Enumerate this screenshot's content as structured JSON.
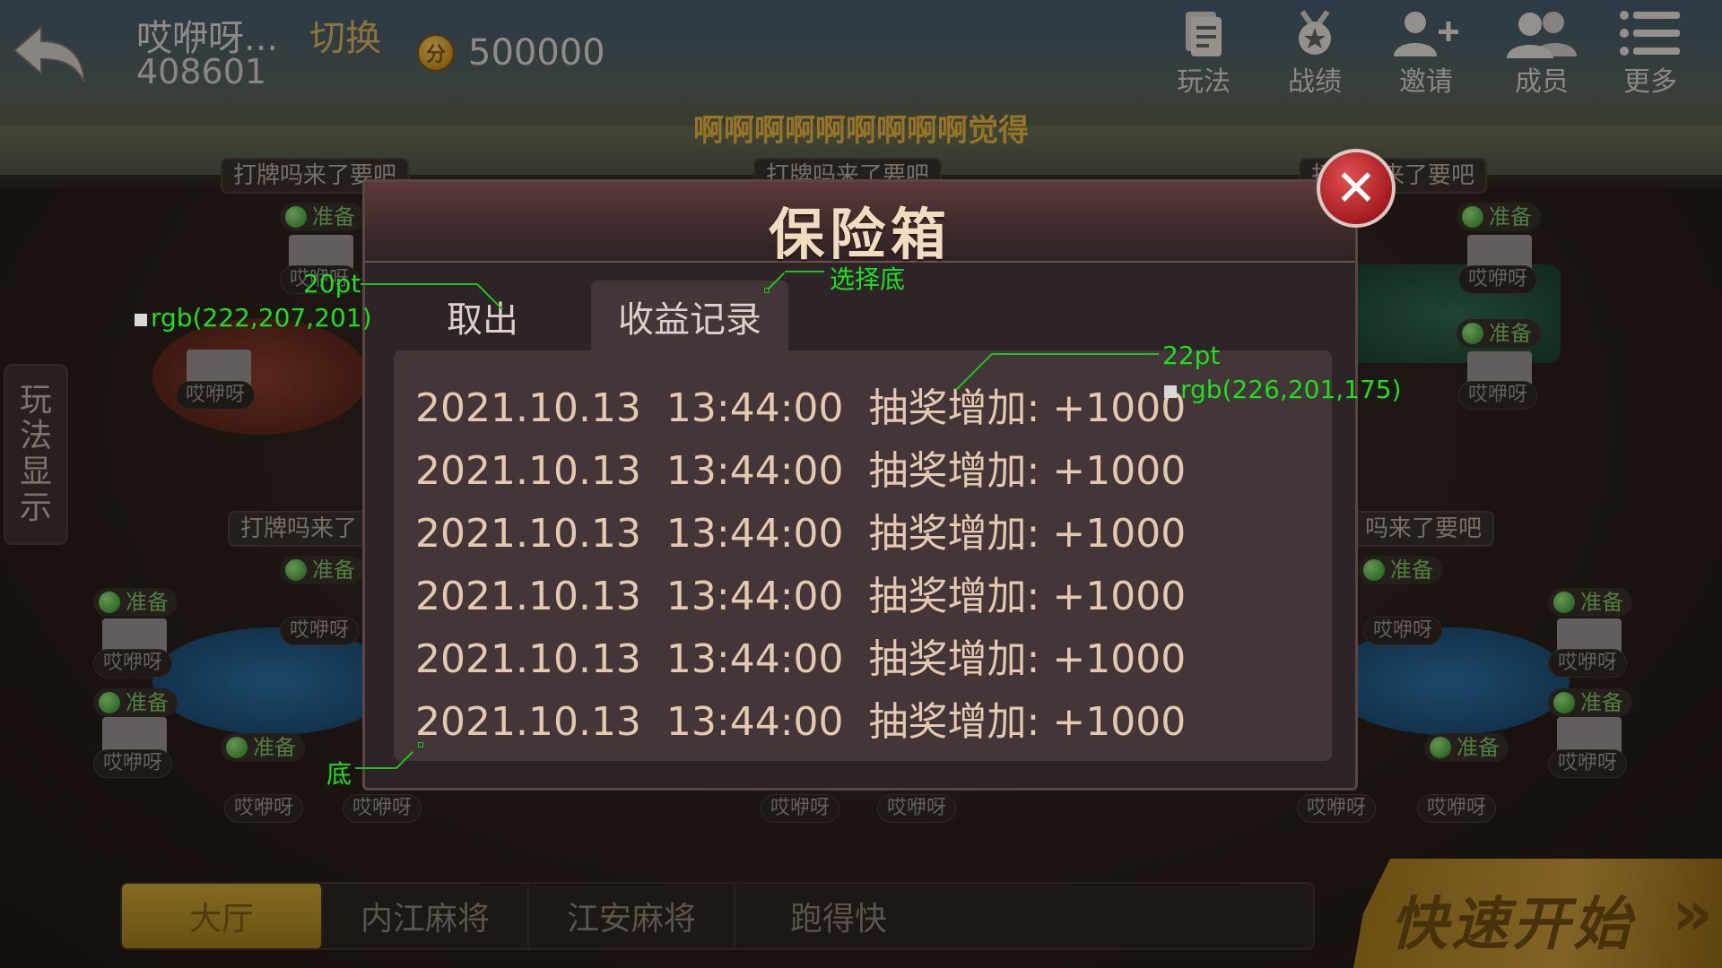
{
  "topbar": {
    "user_name": "哎咿呀...",
    "switch_label": "切换",
    "user_id": "408601",
    "coin_icon_text": "分",
    "coins": "500000",
    "buttons": [
      {
        "label": "玩法",
        "icon": "rules-icon"
      },
      {
        "label": "战绩",
        "icon": "medal-icon"
      },
      {
        "label": "邀请",
        "icon": "add-user-icon"
      },
      {
        "label": "成员",
        "icon": "members-icon"
      },
      {
        "label": "更多",
        "icon": "menu-icon"
      }
    ]
  },
  "marquee": "啊啊啊啊啊啊啊啊啊觉得",
  "side_button": [
    "玩",
    "法",
    "显",
    "示"
  ],
  "background_tables": {
    "table_labels": [
      "打牌吗来了要吧",
      "打牌吗来了要吧",
      "打牌吗来了要吧",
      "打牌吗来了",
      "吗来了要吧"
    ],
    "ready_label": "准备",
    "player_name": "哎咿呀"
  },
  "bottom_tabs": [
    "大厅",
    "内江麻将",
    "江安麻将",
    "跑得快"
  ],
  "quick_start": "快速开始",
  "dialog": {
    "title": "保险箱",
    "close_label": "✕",
    "tabs": [
      "取出",
      "收益记录"
    ],
    "active_tab": 1,
    "records": [
      {
        "date": "2021.10.13",
        "time": "13:44:00",
        "desc": "抽奖增加: +1000"
      },
      {
        "date": "2021.10.13",
        "time": "13:44:00",
        "desc": "抽奖增加: +1000"
      },
      {
        "date": "2021.10.13",
        "time": "13:44:00",
        "desc": "抽奖增加: +1000"
      },
      {
        "date": "2021.10.13",
        "time": "13:44:00",
        "desc": "抽奖增加: +1000"
      },
      {
        "date": "2021.10.13",
        "time": "13:44:00",
        "desc": "抽奖增加: +1000"
      },
      {
        "date": "2021.10.13",
        "time": "13:44:00",
        "desc": "抽奖增加: +1000"
      }
    ]
  },
  "annotations": {
    "tab_font": "20pt",
    "tab_color": "rgb(222,207,201)",
    "selected_bg": "选择底",
    "record_font": "22pt",
    "record_color": "rgb(226,201,175)",
    "panel_bg": "底"
  },
  "colors": {
    "tab_text": "#decfc9",
    "record_text": "#e2c9af",
    "annotation": "#1de01d",
    "accent_gold": "#c9a435",
    "close_red": "#a51c20"
  }
}
